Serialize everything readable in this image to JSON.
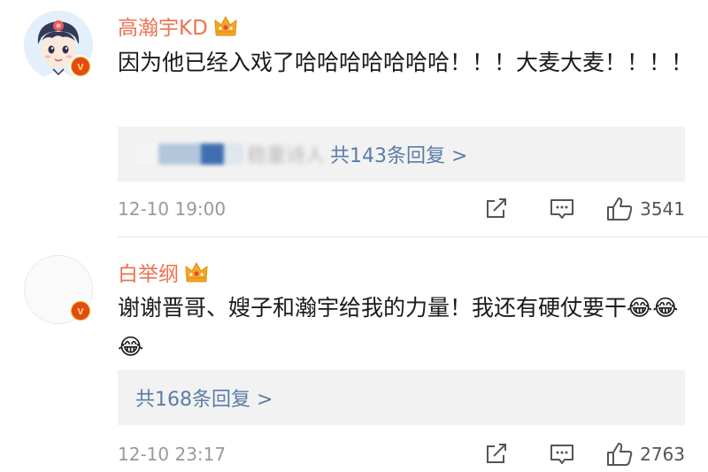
{
  "comments": [
    {
      "username": "高瀚宇KD",
      "text": "因为他已经入戏了哈哈哈哈哈哈哈！！！大麦大麦！！！！",
      "replies_preview_blurred": "稳重诗人",
      "replies_link": "共143条回复 >",
      "time": "12-10 19:00",
      "likes": "3541",
      "icons": [
        "avatar-cartoon",
        "verified-v-icon",
        "crown-icon",
        "share-icon",
        "comment-icon",
        "like-icon"
      ]
    },
    {
      "username": "白举纲",
      "text": "谢谢晋哥、嫂子和瀚宇给我的力量！我还有硬仗要干",
      "emojis": [
        "😂",
        "😂",
        "😂"
      ],
      "replies_link": "共168条回复 >",
      "time": "12-10 23:17",
      "likes": "2763",
      "icons": [
        "avatar-empty",
        "verified-v-icon",
        "crown-icon",
        "share-icon",
        "comment-icon",
        "like-icon"
      ]
    }
  ],
  "badge_letter": "v",
  "colors": {
    "username": "#eb7350",
    "link": "#5b7ca7",
    "reply_box": "#f2f2f2",
    "meta": "#9a9a9a",
    "verified": "#e24a1a"
  }
}
